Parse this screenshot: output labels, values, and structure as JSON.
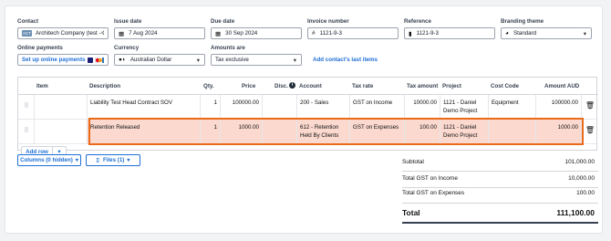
{
  "form": {
    "contact": {
      "label": "Contact",
      "value": "Architech Company (test - 1",
      "badge": "ACT",
      "clear": "×"
    },
    "issue_date": {
      "label": "Issue date",
      "value": "7 Aug 2024"
    },
    "due_date": {
      "label": "Due date",
      "value": "30 Sep 2024"
    },
    "invoice_number": {
      "label": "Invoice number",
      "value": "1121-9-3",
      "prefix": "#"
    },
    "reference": {
      "label": "Reference",
      "value": "1121-9-3"
    },
    "branding": {
      "label": "Branding theme",
      "value": "Standard"
    },
    "online_payments": {
      "label": "Online payments",
      "link": "Set up online payments"
    },
    "currency": {
      "label": "Currency",
      "value": "Australian Dollar"
    },
    "amounts_are": {
      "label": "Amounts are",
      "value": "Tax exclusive"
    },
    "contacts_last_items": "Add contact's last items"
  },
  "table": {
    "headers": [
      "Item",
      "Description",
      "Qty.",
      "Price",
      "Disc.",
      "Account",
      "Tax rate",
      "Tax amount",
      "Project",
      "Cost Code",
      "Amount AUD"
    ],
    "rows": [
      {
        "item": "",
        "description": "Liability Test Head Contract SOV",
        "qty": "1",
        "price": "100000.00",
        "disc": "",
        "account": "200 - Sales",
        "tax_rate": "GST on Income",
        "tax_amount": "10000.00",
        "project": "1121 - Daniel Demo Project",
        "cost_code": "Equipment",
        "amount": "100000.00"
      },
      {
        "item": "",
        "description": "Retention Released",
        "qty": "1",
        "price": "1000.00",
        "disc": "",
        "account": "612 - Retention Held By Clients",
        "tax_rate": "GST on Expenses",
        "tax_amount": "100.00",
        "project": "1121 - Daniel Demo Project",
        "cost_code": "",
        "amount": "1000.00"
      }
    ],
    "add_row": "Add row"
  },
  "columns_button": "Columns (0 hidden)",
  "files_button": "Files (1)",
  "totals": {
    "subtotal_label": "Subtotal",
    "subtotal": "101,000.00",
    "gst_income_label": "Total GST on Income",
    "gst_income": "10,000.00",
    "gst_expenses_label": "Total GST on Expenses",
    "gst_expenses": "100.00",
    "total_label": "Total",
    "total": "111,100.00"
  },
  "colors": {
    "accent": "#1f6fd6",
    "highlight": "#fbd9cf",
    "highlight_border": "#ea6a1a"
  }
}
